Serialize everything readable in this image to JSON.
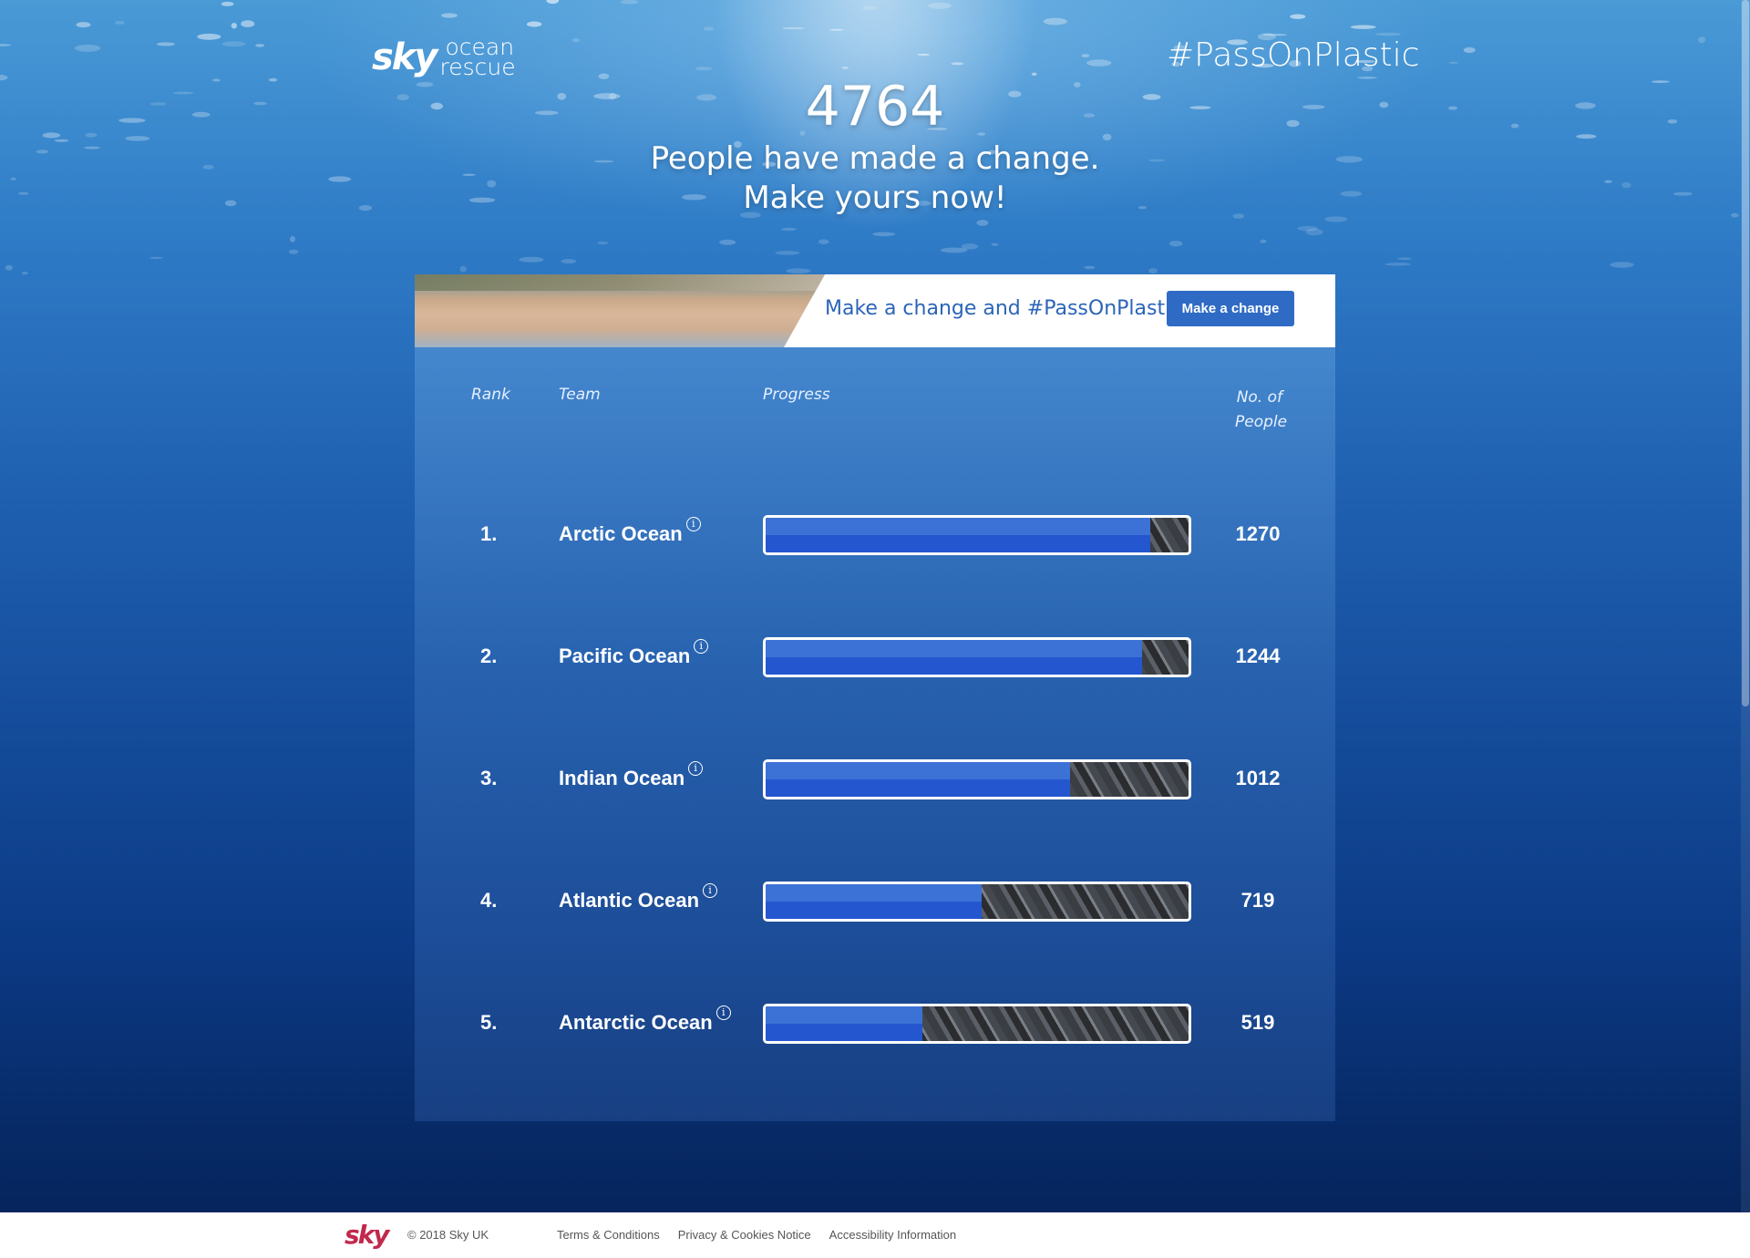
{
  "header": {
    "logo_sky": "sky",
    "logo_line1": "ocean",
    "logo_line2": "rescue",
    "hashtag": "#PassOnPlastic"
  },
  "hero": {
    "count": "4764",
    "line1": "People have made a change.",
    "line2": "Make yours now!"
  },
  "banner": {
    "text": "Make a change and #PassOnPlastic",
    "button_label": "Make a change"
  },
  "table": {
    "headers": {
      "rank": "Rank",
      "team": "Team",
      "progress": "Progress",
      "people": "No. of People"
    },
    "rows": [
      {
        "rank": "1.",
        "team": "Arctic Ocean",
        "progress": 0.91,
        "count": "1270"
      },
      {
        "rank": "2.",
        "team": "Pacific Ocean",
        "progress": 0.89,
        "count": "1244"
      },
      {
        "rank": "3.",
        "team": "Indian Ocean",
        "progress": 0.72,
        "count": "1012"
      },
      {
        "rank": "4.",
        "team": "Atlantic Ocean",
        "progress": 0.51,
        "count": "719"
      },
      {
        "rank": "5.",
        "team": "Antarctic Ocean",
        "progress": 0.37,
        "count": "519"
      }
    ]
  },
  "footer": {
    "logo": "sky",
    "copyright": "© 2018 Sky UK",
    "links": [
      "Terms & Conditions",
      "Privacy & Cookies Notice",
      "Accessibility Information"
    ]
  },
  "colors": {
    "accent": "#2f6bc4",
    "bar_fill": "#2457cf",
    "footer_logo": "#c0294d"
  },
  "icons": {
    "info": "info-icon"
  }
}
